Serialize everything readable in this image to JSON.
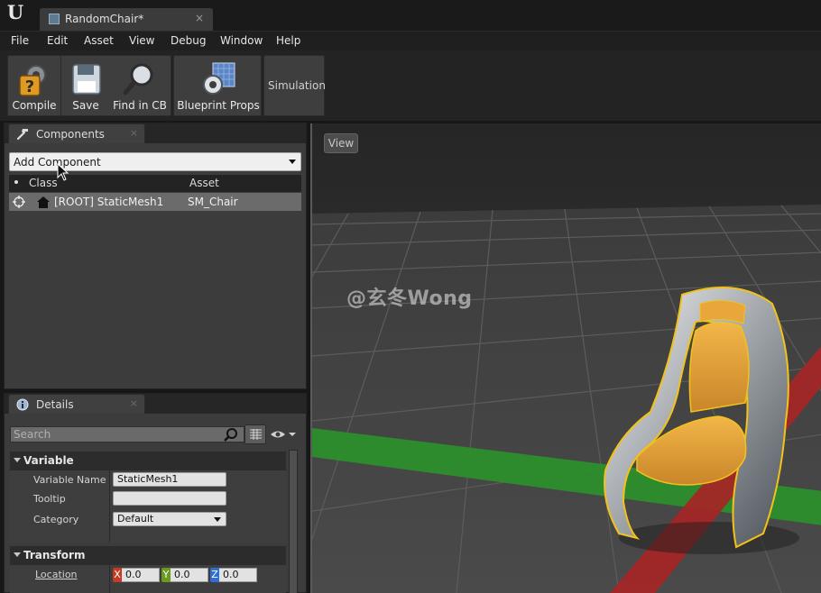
{
  "window": {
    "logo_text": "U",
    "tab_title": "RandomChair*",
    "tab_close": "×"
  },
  "menu": {
    "items": [
      "File",
      "Edit",
      "Asset",
      "View",
      "Debug",
      "Window",
      "Help"
    ]
  },
  "toolbar": {
    "buttons": [
      {
        "label": "Compile",
        "icon": "compile-icon"
      },
      {
        "label": "Save",
        "icon": "save-icon"
      },
      {
        "label": "Find in CB",
        "icon": "find-in-cb-icon"
      },
      {
        "label": "Blueprint Props",
        "icon": "blueprint-props-icon"
      }
    ],
    "simulation_label": "Simulation"
  },
  "components_panel": {
    "tab_label": "Components",
    "tab_close": "×",
    "add_component_label": "Add Component",
    "columns": {
      "class": "Class",
      "asset": "Asset"
    },
    "rows": [
      {
        "class": "[ROOT] StaticMesh1",
        "asset": "SM_Chair"
      }
    ]
  },
  "details_panel": {
    "tab_label": "Details",
    "tab_close": "×",
    "search_placeholder": "Search",
    "variable_section": {
      "title": "Variable",
      "variable_name_label": "Variable Name",
      "variable_name_value": "StaticMesh1",
      "tooltip_label": "Tooltip",
      "tooltip_value": "",
      "category_label": "Category",
      "category_value": "Default"
    },
    "transform_section": {
      "title": "Transform",
      "location_label": "Location",
      "location": {
        "x": "0.0",
        "y": "0.0",
        "z": "0.0"
      },
      "axis_labels": {
        "x": "X",
        "y": "Y",
        "z": "Z"
      }
    }
  },
  "viewport": {
    "view_button": "View",
    "watermark": "@玄冬Wong"
  },
  "colors": {
    "x_axis": "#c23b22",
    "y_axis": "#6a9a1f",
    "z_axis": "#2e6fd1",
    "grid_green": "#2c8f2c",
    "grid_red": "#a32626",
    "chair_seat": "#e1a23a",
    "selection_outline": "#f2c21a"
  }
}
